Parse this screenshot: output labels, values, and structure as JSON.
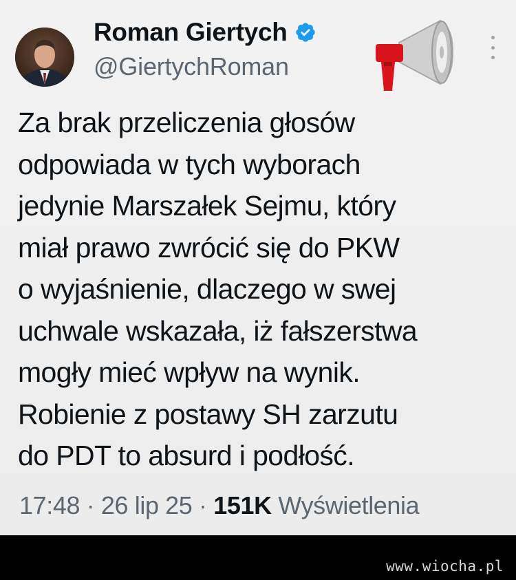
{
  "tweet": {
    "author_name": "Roman Giertych",
    "handle": "@GiertychRoman",
    "text_lines": [
      "Za brak przeliczenia głosów",
      "odpowiada w tych wyborach",
      "jedynie Marszałek Sejmu, który",
      "miał prawo zwrócić się do PKW",
      "o wyjaśnienie, dlaczego w swej",
      "uchwale wskazała, iż fałszerstwa",
      "mogły mieć wpływ na wynik.",
      "Robienie z postawy SH zarzutu",
      "do PDT to absurd i podłość."
    ],
    "time": "17:48",
    "separator": "·",
    "date": "26 lip 25",
    "views_count": "151K",
    "views_label": "Wyświetlenia"
  },
  "icons": {
    "verified": "verified-badge-icon",
    "megaphone": "megaphone-icon",
    "more": "more-options-icon"
  },
  "colors": {
    "verified_blue": "#1d9bf0",
    "text_primary": "#0f1419",
    "text_secondary": "#5b6670",
    "megaphone_red": "#d9141c"
  },
  "footer": {
    "watermark": "www.wiocha.pl"
  }
}
